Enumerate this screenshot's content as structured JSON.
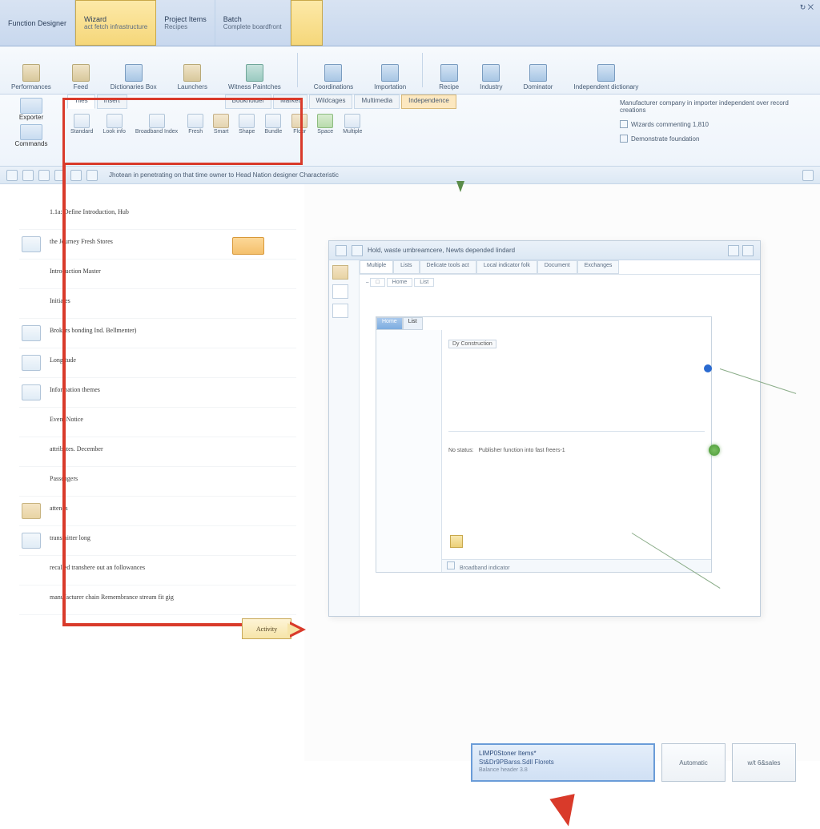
{
  "titlebar": {
    "tabs": [
      {
        "t1": "Function Designer",
        "t2": ""
      },
      {
        "t1": "Wizard",
        "t2": "act fetch infrastructure"
      },
      {
        "t1": "Project Items",
        "t2": "Recipes"
      },
      {
        "t1": "Batch",
        "t2": "Complete boardfront"
      },
      {
        "t1": "",
        "t2": ""
      }
    ],
    "controls": "↻ ⨉"
  },
  "ribbon1": {
    "groups": [
      {
        "lbl": "Performances"
      },
      {
        "lbl": "Feed"
      },
      {
        "lbl": "Dictionaries Box"
      },
      {
        "lbl": "Launchers"
      },
      {
        "lbl": "Witness Paintches"
      },
      {
        "lbl": "Coordinations"
      },
      {
        "lbl": "Importation"
      },
      {
        "lbl": "Recipe"
      },
      {
        "lbl": "Industry"
      },
      {
        "lbl": "Dominator"
      },
      {
        "lbl": "Independent dictionary"
      }
    ]
  },
  "ribbon2": {
    "left": [
      {
        "lbl": "Exporter"
      },
      {
        "lbl": "Commands"
      }
    ],
    "tabs": [
      {
        "lbl": "Tiles"
      },
      {
        "lbl": "Insert"
      },
      {
        "lbl": "Bookholder"
      },
      {
        "lbl": "Market"
      },
      {
        "lbl": "Wildcages"
      },
      {
        "lbl": "Multimedia"
      },
      {
        "lbl": "Independence"
      }
    ],
    "buttons": [
      {
        "lbl": "Standard"
      },
      {
        "lbl": "Look info"
      },
      {
        "lbl": "Broadband Index"
      },
      {
        "lbl": "Fresh"
      },
      {
        "lbl": "Smart"
      },
      {
        "lbl": "Shape"
      },
      {
        "lbl": "Bundle"
      },
      {
        "lbl": "Floor"
      },
      {
        "lbl": "Space"
      },
      {
        "lbl": "Multiple"
      }
    ],
    "right": [
      "Manufacturer company in importer independent over record creations",
      "Wizards commenting 1,810",
      "Demonstrate foundation"
    ]
  },
  "qabar": {
    "text": "Jhotean in penetrating on that time owner to Head Nation designer Characteristic"
  },
  "side": {
    "items": [
      {
        "txt": "1.1a: Define Introduction, Hub"
      },
      {
        "txt": "the Journey Fresh Stores"
      },
      {
        "txt": "Introduction Master"
      },
      {
        "txt": "Initiates"
      },
      {
        "txt": "Brokers bonding Ind. Bellmenter)"
      },
      {
        "txt": "Longitude"
      },
      {
        "txt": "Information themes"
      },
      {
        "txt": "Event Notice"
      },
      {
        "txt": "attributes. December"
      },
      {
        "txt": "Passengers"
      },
      {
        "txt": "attends"
      },
      {
        "txt": "transmitter long"
      },
      {
        "txt": "recalled transhere out an followances"
      },
      {
        "txt": "manufacturer chain Remembrance stream fit gig"
      }
    ]
  },
  "innerwin": {
    "title": "Hold, waste umbreamcere, Newts depended lindard",
    "tabs": [
      "Multiple",
      "Lists",
      "Delicate tools act",
      "Local indicator folk",
      "Document",
      "Exchanges"
    ],
    "browser": {
      "tabs": [
        "Home",
        "List"
      ],
      "row1": "Dy Construction",
      "msg_label": "No&nbsp;status:",
      "msg": "Publisher function into fast freers-1",
      "status": "Broadband indicator"
    }
  },
  "callout": {
    "label": "Activity"
  },
  "footer": {
    "status": {
      "s1": "LIMP0Stoner Items*",
      "s2": "St&amp;Dr9PBarss.Sdll Florets",
      "s3": "Balance header 3.8"
    },
    "btn1": "Automatic",
    "btn2": "w/t 6&amp;sales"
  }
}
